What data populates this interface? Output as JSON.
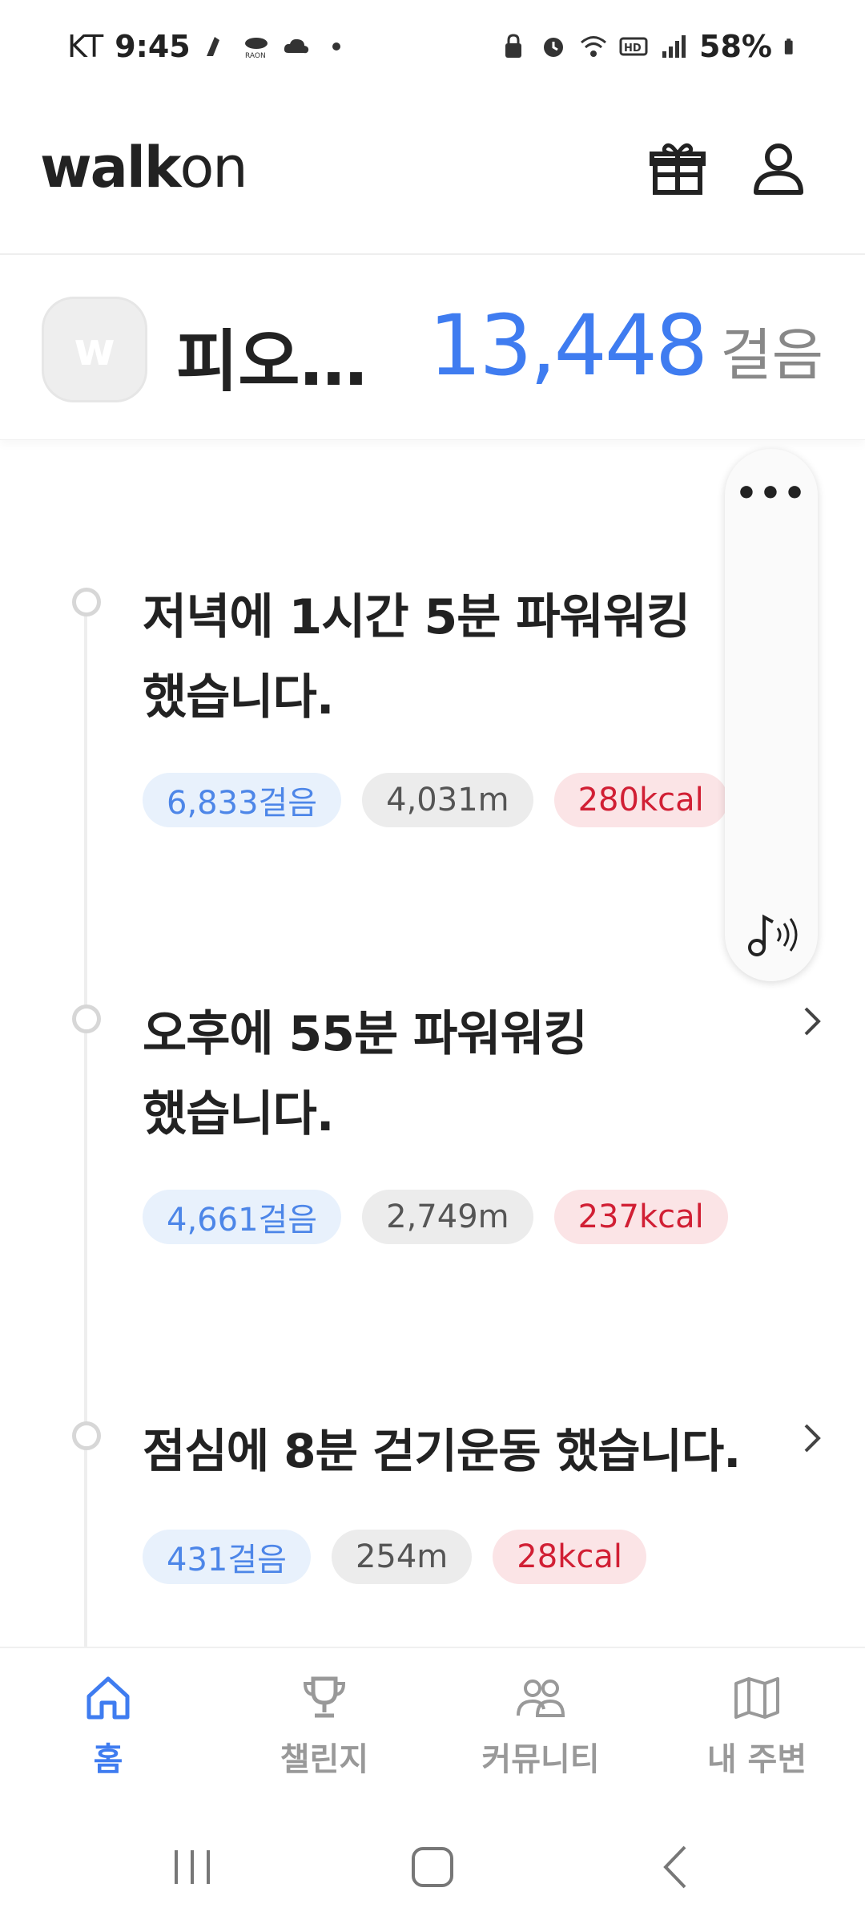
{
  "status_bar": {
    "carrier": "KT",
    "time": "9:45",
    "battery": "58%"
  },
  "header": {
    "logo_bold": "walk",
    "logo_light": "on"
  },
  "summary": {
    "avatar_letter": "w",
    "username": "피오…",
    "total_steps": "13,448",
    "steps_unit": "걸음"
  },
  "entries": [
    {
      "title_line1": "저녁에 1시간 5분 파워워킹",
      "title_line2": "했습니다.",
      "steps": "6,833걸음",
      "distance": "4,031m",
      "kcal": "280kcal"
    },
    {
      "title_line1": "오후에 55분 파워워킹",
      "title_line2": "했습니다.",
      "steps": "4,661걸음",
      "distance": "2,749m",
      "kcal": "237kcal"
    },
    {
      "title_line1": "점심에 8분 걷기운동 했습니다.",
      "steps": "431걸음",
      "distance": "254m",
      "kcal": "28kcal"
    }
  ],
  "side_pill": {
    "more_label": "•••"
  },
  "bottom_nav": [
    {
      "label": "홈",
      "icon": "home-icon",
      "active": true
    },
    {
      "label": "챌린지",
      "icon": "trophy-icon",
      "active": false
    },
    {
      "label": "커뮤니티",
      "icon": "people-icon",
      "active": false
    },
    {
      "label": "내 주변",
      "icon": "map-icon",
      "active": false
    }
  ],
  "colors": {
    "accent": "#3f7cf0",
    "steps_chip_bg": "#e8f1fc",
    "kcal_text": "#d11f34"
  }
}
